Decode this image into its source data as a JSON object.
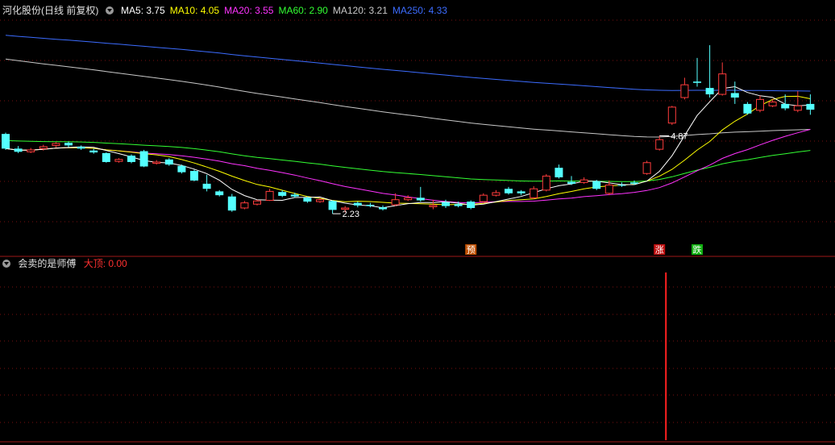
{
  "upper_legend": {
    "stock_name": "河化股份",
    "period_mode": "(日线 前复权)",
    "ma": [
      {
        "label": "MA5: 3.75",
        "color": "#ffffff"
      },
      {
        "label": "MA10: 4.05",
        "color": "#ffff00"
      },
      {
        "label": "MA20: 3.55",
        "color": "#ff33ff"
      },
      {
        "label": "MA60: 2.90",
        "color": "#33ff33"
      },
      {
        "label": "MA120: 3.21",
        "color": "#c8c8c8"
      },
      {
        "label": "MA250: 4.33",
        "color": "#3c6cff"
      }
    ]
  },
  "lower_legend": {
    "indicator_name": "会卖的是师傅",
    "value_label": "大顶: 0.00",
    "value_color": "#ff3030"
  },
  "markers": [
    {
      "text": "预",
      "bar": 37
    },
    {
      "text": "涨",
      "bar": 52
    },
    {
      "text": "跌",
      "bar": 55
    }
  ],
  "chart_data": {
    "type": "candlestick",
    "ylim": [
      1.6,
      5.3
    ],
    "high_label": "4.87",
    "low_label": "2.23",
    "high_bar": 52,
    "low_bar": 26,
    "colors": {
      "up": "#ff3c3c",
      "down": "#54ffff"
    },
    "candles": [
      [
        3.48,
        3.25,
        3.5,
        3.23
      ],
      [
        3.25,
        3.2,
        3.29,
        3.18
      ],
      [
        3.2,
        3.23,
        3.26,
        3.18
      ],
      [
        3.25,
        3.28,
        3.31,
        3.22
      ],
      [
        3.3,
        3.33,
        3.35,
        3.27
      ],
      [
        3.34,
        3.3,
        3.36,
        3.27
      ],
      [
        3.28,
        3.25,
        3.3,
        3.23
      ],
      [
        3.22,
        3.19,
        3.25,
        3.17
      ],
      [
        3.18,
        3.04,
        3.19,
        3.03
      ],
      [
        3.05,
        3.08,
        3.1,
        3.03
      ],
      [
        3.14,
        3.04,
        3.16,
        3.02
      ],
      [
        3.21,
        2.97,
        3.23,
        2.96
      ],
      [
        3.02,
        3.04,
        3.07,
        3.0
      ],
      [
        3.08,
        3.0,
        3.1,
        2.98
      ],
      [
        2.98,
        2.88,
        3.0,
        2.86
      ],
      [
        2.9,
        2.75,
        2.92,
        2.74
      ],
      [
        2.7,
        2.62,
        2.84,
        2.58
      ],
      [
        2.58,
        2.52,
        2.6,
        2.5
      ],
      [
        2.5,
        2.28,
        2.54,
        2.26
      ],
      [
        2.32,
        2.4,
        2.43,
        2.3
      ],
      [
        2.38,
        2.43,
        2.45,
        2.36
      ],
      [
        2.44,
        2.58,
        2.62,
        2.43
      ],
      [
        2.57,
        2.51,
        2.6,
        2.49
      ],
      [
        2.53,
        2.5,
        2.56,
        2.48
      ],
      [
        2.48,
        2.42,
        2.5,
        2.4
      ],
      [
        2.42,
        2.45,
        2.48,
        2.4
      ],
      [
        2.43,
        2.29,
        2.44,
        2.23
      ],
      [
        2.3,
        2.32,
        2.35,
        2.25
      ],
      [
        2.4,
        2.36,
        2.42,
        2.33
      ],
      [
        2.37,
        2.35,
        2.4,
        2.33
      ],
      [
        2.33,
        2.3,
        2.36,
        2.28
      ],
      [
        2.37,
        2.45,
        2.55,
        2.35
      ],
      [
        2.45,
        2.48,
        2.52,
        2.43
      ],
      [
        2.48,
        2.44,
        2.65,
        2.42
      ],
      [
        2.34,
        2.36,
        2.45,
        2.3
      ],
      [
        2.41,
        2.35,
        2.45,
        2.32
      ],
      [
        2.38,
        2.35,
        2.42,
        2.33
      ],
      [
        2.42,
        2.32,
        2.44,
        2.3
      ],
      [
        2.42,
        2.52,
        2.55,
        2.4
      ],
      [
        2.52,
        2.56,
        2.6,
        2.5
      ],
      [
        2.62,
        2.55,
        2.65,
        2.53
      ],
      [
        2.58,
        2.55,
        2.6,
        2.52
      ],
      [
        2.48,
        2.62,
        2.66,
        2.46
      ],
      [
        2.6,
        2.82,
        2.85,
        2.58
      ],
      [
        2.95,
        2.8,
        3.0,
        2.78
      ],
      [
        2.73,
        2.7,
        2.82,
        2.68
      ],
      [
        2.72,
        2.76,
        2.8,
        2.7
      ],
      [
        2.74,
        2.62,
        2.76,
        2.6
      ],
      [
        2.55,
        2.68,
        2.75,
        2.52
      ],
      [
        2.68,
        2.67,
        2.72,
        2.65
      ],
      [
        2.72,
        2.7,
        2.75,
        2.68
      ],
      [
        2.86,
        3.03,
        3.06,
        2.84
      ],
      [
        3.24,
        3.39,
        3.45,
        3.22
      ],
      [
        3.65,
        3.9,
        3.92,
        3.62
      ],
      [
        4.05,
        4.25,
        4.36,
        4.02
      ],
      [
        4.3,
        4.28,
        4.67,
        4.22
      ],
      [
        4.2,
        4.1,
        4.87,
        4.05
      ],
      [
        4.1,
        4.42,
        4.6,
        4.08
      ],
      [
        4.12,
        4.05,
        4.3,
        3.95
      ],
      [
        3.95,
        3.8,
        3.98,
        3.78
      ],
      [
        3.85,
        4.02,
        4.08,
        3.82
      ],
      [
        3.92,
        3.98,
        4.03,
        3.9
      ],
      [
        3.95,
        3.88,
        4.1,
        3.85
      ],
      [
        3.85,
        3.92,
        4.15,
        3.82
      ],
      [
        3.95,
        3.86,
        4.1,
        3.78
      ]
    ]
  }
}
